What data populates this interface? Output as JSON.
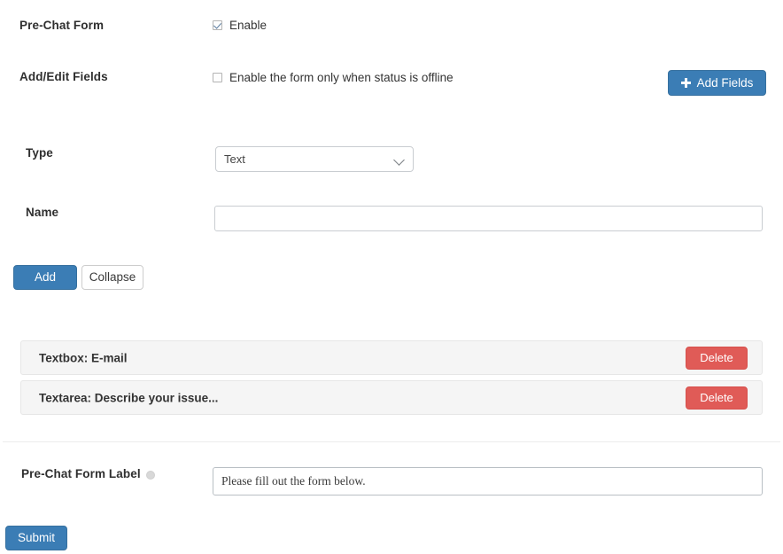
{
  "form": {
    "prechat_label": "Pre-Chat Form",
    "enable_checkbox": {
      "label": "Enable",
      "checked": true
    },
    "addedit_label": "Add/Edit Fields",
    "offline_checkbox": {
      "label": "Enable the form only when status is offline",
      "checked": false
    },
    "add_fields_button": "Add Fields",
    "add_fields_icon": "plus-icon",
    "type_label": "Type",
    "type_value": "Text",
    "type_options": [
      "Text"
    ],
    "type_chevron_icon": "chevron-down-icon",
    "name_label": "Name",
    "name_value": "",
    "add_button": "Add",
    "collapse_button": "Collapse",
    "fields": [
      {
        "text": "Textbox: E-mail",
        "delete_label": "Delete"
      },
      {
        "text": "Textarea: Describe your issue...",
        "delete_label": "Delete"
      }
    ],
    "prechat_form_label": "Pre-Chat Form Label",
    "prechat_form_label_info_icon": "info-icon",
    "prechat_form_label_value": "Please fill out the form below.",
    "submit_button": "Submit"
  },
  "colors": {
    "primary": "#3b7db5",
    "danger": "#e05b57",
    "panel_bg": "#f5f5f5",
    "border": "#c9cdd1"
  }
}
